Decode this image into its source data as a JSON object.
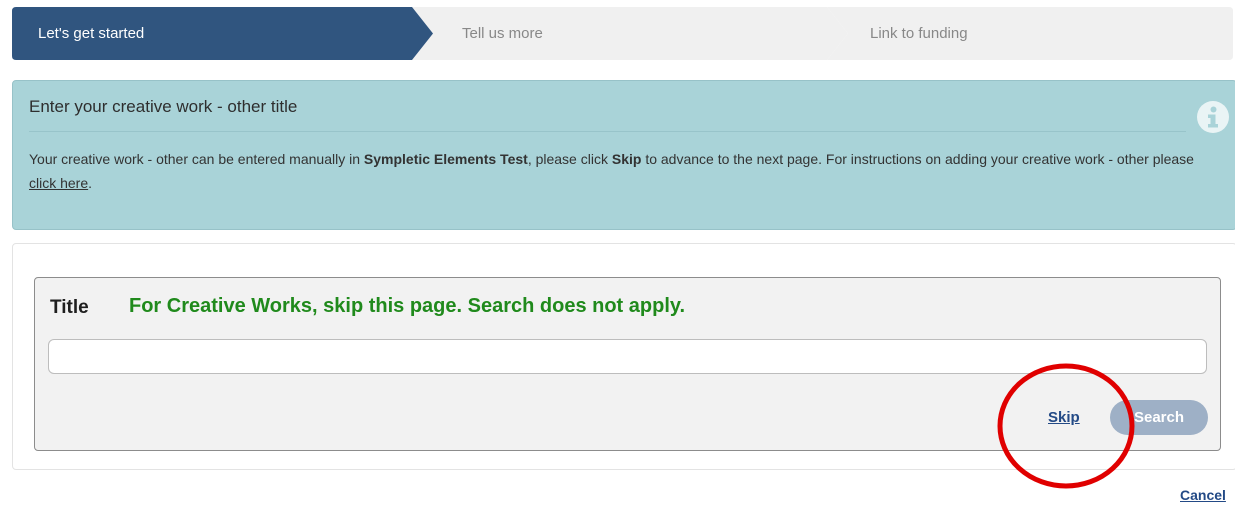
{
  "wizard": {
    "steps": [
      {
        "label": "Let's get started",
        "state": "active"
      },
      {
        "label": "Tell us more",
        "state": "inactive"
      },
      {
        "label": "Link to funding",
        "state": "inactive"
      }
    ],
    "active_color": "#30557f",
    "inactive_color": "#f0f0f0"
  },
  "info_panel": {
    "title": "Enter your creative work - other title",
    "text_1": "Your creative work - other can be entered manually in ",
    "system_name": "Sympletic Elements Test",
    "text_2": ", please click ",
    "skip_word": "Skip",
    "text_3": " to advance to the next page. For instructions on adding your creative work - other please ",
    "link_text": "click here",
    "text_4": ".",
    "icon": "info-circle-icon",
    "background": "#a9d3d8"
  },
  "search": {
    "title_label": "Title",
    "notice": "For Creative Works, skip this page. Search does not apply.",
    "notice_color": "#208a1c",
    "title_value": "",
    "skip_label": "Skip",
    "search_label": "Search"
  },
  "annotation": {
    "shape": "circle",
    "color": "#e00000",
    "target": "skip-link"
  },
  "footer": {
    "cancel_label": "Cancel"
  }
}
